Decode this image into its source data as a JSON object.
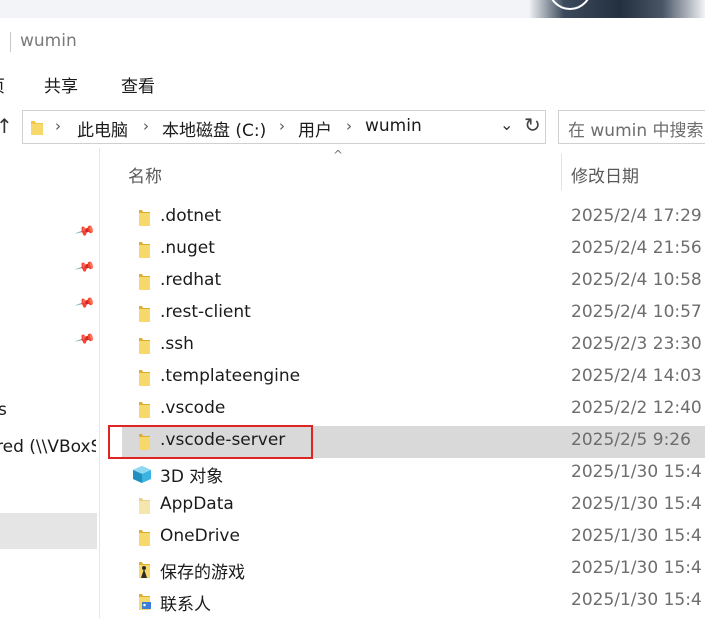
{
  "window": {
    "title": "wumin"
  },
  "ribbon": {
    "tabs": [
      "页",
      "共享",
      "查看"
    ]
  },
  "address": {
    "crumbs": [
      "此电脑",
      "本地磁盘 (C:)",
      "用户",
      "wumin"
    ],
    "search_placeholder": "在 wumin 中搜索"
  },
  "nav": {
    "items": [
      {
        "label": "s"
      },
      {
        "label": "red (\\\\VBoxSv"
      }
    ]
  },
  "list": {
    "columns": {
      "name": "名称",
      "date": "修改日期"
    },
    "rows": [
      {
        "name": ".dotnet",
        "date": "2025/2/4 17:29",
        "icon": "folder-icon"
      },
      {
        "name": ".nuget",
        "date": "2025/2/4 21:56",
        "icon": "folder-icon"
      },
      {
        "name": ".redhat",
        "date": "2025/2/4 10:58",
        "icon": "folder-icon"
      },
      {
        "name": ".rest-client",
        "date": "2025/2/4 10:57",
        "icon": "folder-icon"
      },
      {
        "name": ".ssh",
        "date": "2025/2/3 23:30",
        "icon": "folder-icon"
      },
      {
        "name": ".templateengine",
        "date": "2025/2/4 14:03",
        "icon": "folder-icon"
      },
      {
        "name": ".vscode",
        "date": "2025/2/2 12:40",
        "icon": "folder-icon"
      },
      {
        "name": ".vscode-server",
        "date": "2025/2/5 9:26",
        "icon": "folder-icon",
        "selected": true
      },
      {
        "name": "3D 对象",
        "date": "2025/1/30 15:4",
        "icon": "3d-objects-icon"
      },
      {
        "name": "AppData",
        "date": "2025/1/30 15:4",
        "icon": "folder-icon"
      },
      {
        "name": "OneDrive",
        "date": "2025/1/30 15:4",
        "icon": "folder-icon"
      },
      {
        "name": "保存的游戏",
        "date": "2025/1/30 15:4",
        "icon": "saved-games-icon"
      },
      {
        "name": "联系人",
        "date": "2025/1/30 15:4",
        "icon": "contacts-icon"
      }
    ]
  },
  "colors": {
    "folder": "#f2c94c",
    "selection": "#d9d9d9",
    "highlight": "#e02424"
  }
}
